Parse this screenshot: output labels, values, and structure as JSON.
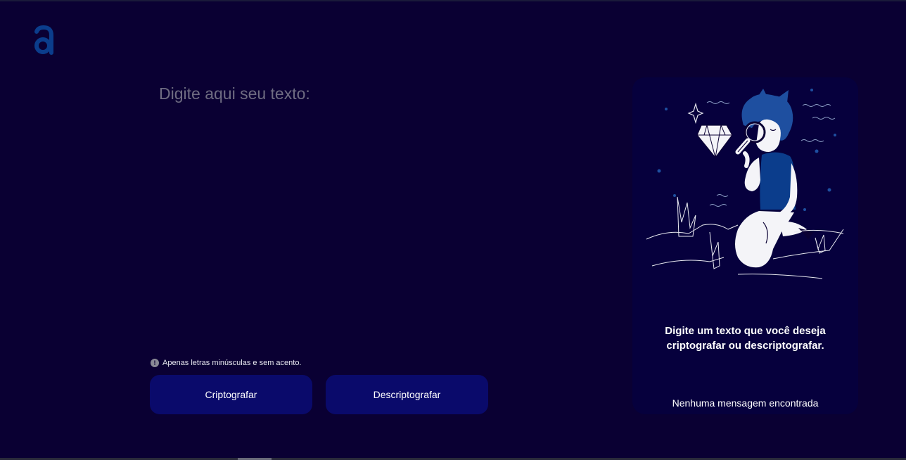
{
  "app": {
    "logo_icon": "alura-logo-icon"
  },
  "input": {
    "placeholder": "Digite aqui seu texto:",
    "value": ""
  },
  "hint": {
    "icon": "info-icon",
    "text": "Apenas letras minúsculas e sem acento."
  },
  "buttons": {
    "encrypt_label": "Criptografar",
    "decrypt_label": "Descriptografar"
  },
  "output": {
    "illustration": "person-with-magnifying-glass-illustration",
    "title": "Digite um texto que você deseja criptografar ou descriptografar.",
    "empty_message": "Nenhuma mensagem encontrada"
  },
  "colors": {
    "background": "#0a0033",
    "panel": "#06003d",
    "button": "#0a0a6b",
    "accent": "#0b3d8c"
  }
}
